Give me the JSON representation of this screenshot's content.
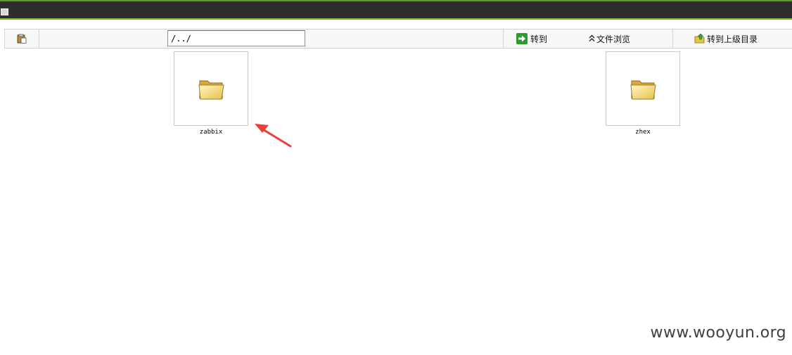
{
  "toolbar": {
    "path_value": "/../",
    "goto_label": "转到",
    "browse_label": "文件浏览",
    "up_label": "转到上级目录"
  },
  "icons": {
    "paste": "paste-icon",
    "goto": "green-arrow-icon",
    "browse": "double-chevron-up-icon",
    "up": "folder-up-icon",
    "folder": "folder-icon"
  },
  "folders": [
    {
      "name": "zabbix"
    },
    {
      "name": "zhex"
    }
  ],
  "annotation": {
    "type": "arrow",
    "color": "#e8403a",
    "points_to": "zabbix"
  },
  "watermark": "www.wooyun.org",
  "colors": {
    "titlebar": "#2e2e2e",
    "accent": "#7cbf2a"
  }
}
